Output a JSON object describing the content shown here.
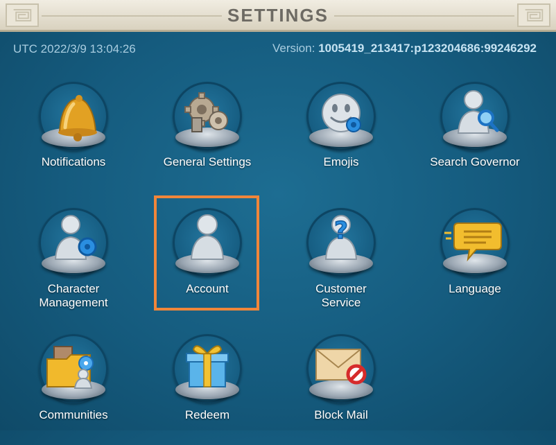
{
  "header": {
    "title": "SETTINGS"
  },
  "info": {
    "utc": "UTC 2022/3/9 13:04:26",
    "version_label": "Version:",
    "version_value": "1005419_213417:p123204686:99246292"
  },
  "items": [
    {
      "label": "Notifications",
      "icon": "bell-icon"
    },
    {
      "label": "General Settings",
      "icon": "gears-icon"
    },
    {
      "label": "Emojis",
      "icon": "smiley-icon"
    },
    {
      "label": "Search Governor",
      "icon": "search-user-icon"
    },
    {
      "label": "Character Management",
      "label_line1": "Character",
      "label_line2": "Management",
      "icon": "user-gear-icon"
    },
    {
      "label": "Account",
      "icon": "user-icon"
    },
    {
      "label": "Customer Service",
      "label_line1": "Customer",
      "label_line2": "Service",
      "icon": "user-question-icon"
    },
    {
      "label": "Language",
      "icon": "speech-bubble-icon"
    },
    {
      "label": "Communities",
      "icon": "folder-community-icon"
    },
    {
      "label": "Redeem",
      "icon": "gift-icon"
    },
    {
      "label": "Block Mail",
      "icon": "mail-block-icon"
    }
  ],
  "colors": {
    "highlight": "#f0863a",
    "background": "#155b7e"
  }
}
